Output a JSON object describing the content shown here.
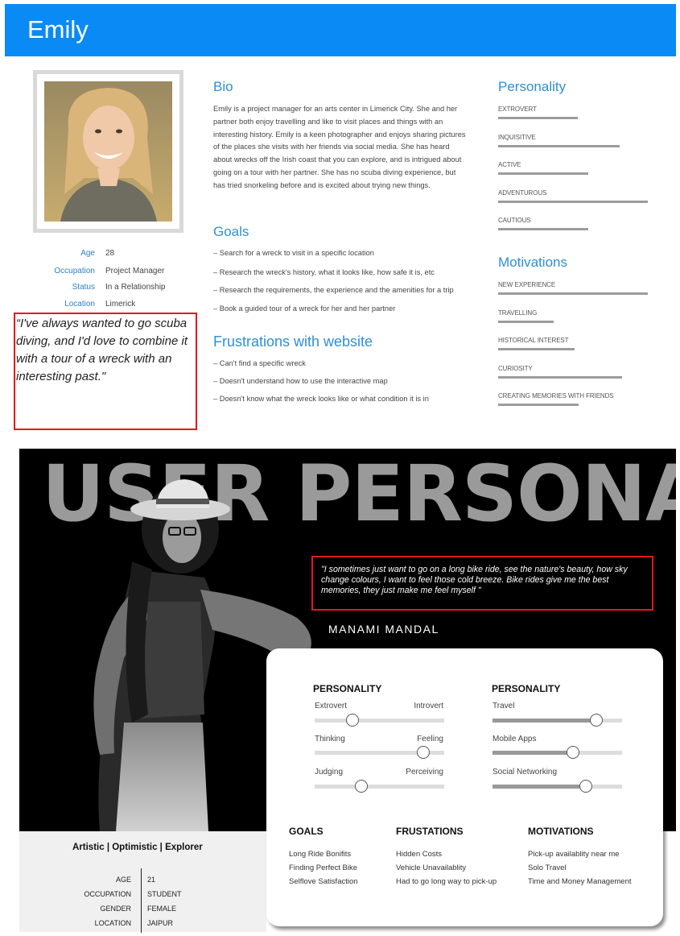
{
  "emily": {
    "name": "Emily",
    "demographics": [
      {
        "label": "Age",
        "value": "28"
      },
      {
        "label": "Occupation",
        "value": "Project Manager"
      },
      {
        "label": "Status",
        "value": "In a Relationship"
      },
      {
        "label": "Location",
        "value": "Limerick"
      }
    ],
    "quote": "“I've always wanted to go scuba diving, and I'd love to combine it with a tour of a wreck with an interesting past.\"",
    "bio_title": "Bio",
    "bio": "Emily is a project manager for an arts center in Limerick City. She and her partner both enjoy travelling and like to visit places and things with an interesting history. Emily is a keen photographer and enjoys sharing pictures of the places she visits with her friends via social media. She has heard about wrecks off the Irish coast that you can explore, and is intrigued about going on a tour with her partner. She has no scuba diving experience, but has tried snorkeling before and is excited about trying new things.",
    "goals_title": "Goals",
    "goals": [
      "– Search for a wreck to visit in a specific location",
      "– Research the wreck's history, what it looks like, how safe it is, etc",
      "– Research the requirements, the experience and the amenities for a trip",
      "– Book a guided tour of a wreck for her and her partner"
    ],
    "frustrations_title": "Frustrations with website",
    "frustrations": [
      "– Can't find a specific wreck",
      "– Doesn't understand how to use the interactive map",
      "– Doesn't know what the wreck looks like or what condition it is in"
    ],
    "personality_title": "Personality",
    "personality": [
      {
        "label": "Extrovert",
        "level": 0.53
      },
      {
        "label": "Inquisitive",
        "level": 0.81
      },
      {
        "label": "Active",
        "level": 0.6
      },
      {
        "label": "Adventurous",
        "level": 1.0
      },
      {
        "label": "Cautious",
        "level": 0.6
      }
    ],
    "motivations_title": "Motivations",
    "motivations": [
      {
        "label": "New Experience",
        "level": 1.0
      },
      {
        "label": "Travelling",
        "level": 0.37
      },
      {
        "label": "Historical Interest",
        "level": 0.51
      },
      {
        "label": "Curiosity",
        "level": 0.83
      },
      {
        "label": "Creating Memories with Friends",
        "level": 0.54
      }
    ]
  },
  "manami": {
    "banner": "USER PERSONA",
    "quote": "\"I sometimes just want to go on a long bike ride, see the nature's beauty, how sky change colours, I want to feel those cold breeze. Bike rides give me the best memories, they just make me feel myself \"",
    "name": "MANAMI  MANDAL",
    "personality_title": "PERSONALITY",
    "personality_sliders": [
      {
        "left": "Extrovert",
        "right": "Introvert",
        "level": 0.29
      },
      {
        "left": "Thinking",
        "right": "Feeling",
        "level": 0.84
      },
      {
        "left": "Judging",
        "right": "Perceiving",
        "level": 0.36
      }
    ],
    "interests_title": "PERSONALITY",
    "interests": [
      {
        "label": "Travel",
        "level": 0.8
      },
      {
        "label": "Mobile Apps",
        "level": 0.62
      },
      {
        "label": "Social Networking",
        "level": 0.72
      }
    ],
    "goals_title": "GOALS",
    "goals": [
      "Long Ride Bonifits",
      "Finding Perfect Bike",
      "Selflove Satisfaction"
    ],
    "frustrations_title": "FRUSTATIONS",
    "frustrations": [
      "Hidden Costs",
      "Vehicle Unavailablity",
      "Had to go long way to pick-up"
    ],
    "motivations_title": "MOTIVATIONS",
    "motivations": [
      "Pick-up availablity near me",
      "Solo Travel",
      "Time and Money Management"
    ],
    "tagline": "Artistic | Optimistic | Explorer",
    "demographics": [
      {
        "label": "AGE",
        "value": "21"
      },
      {
        "label": "OCCUPATION",
        "value": "STUDENT"
      },
      {
        "label": "GENDER",
        "value": "FEMALE"
      },
      {
        "label": "LOCATION",
        "value": "JAIPUR"
      }
    ]
  },
  "colors": {
    "header_blue": "#0a8af5",
    "heading_blue": "#2f8fd6",
    "highlight_red": "#e8161a",
    "banner_grey": "#9a9a9a"
  }
}
